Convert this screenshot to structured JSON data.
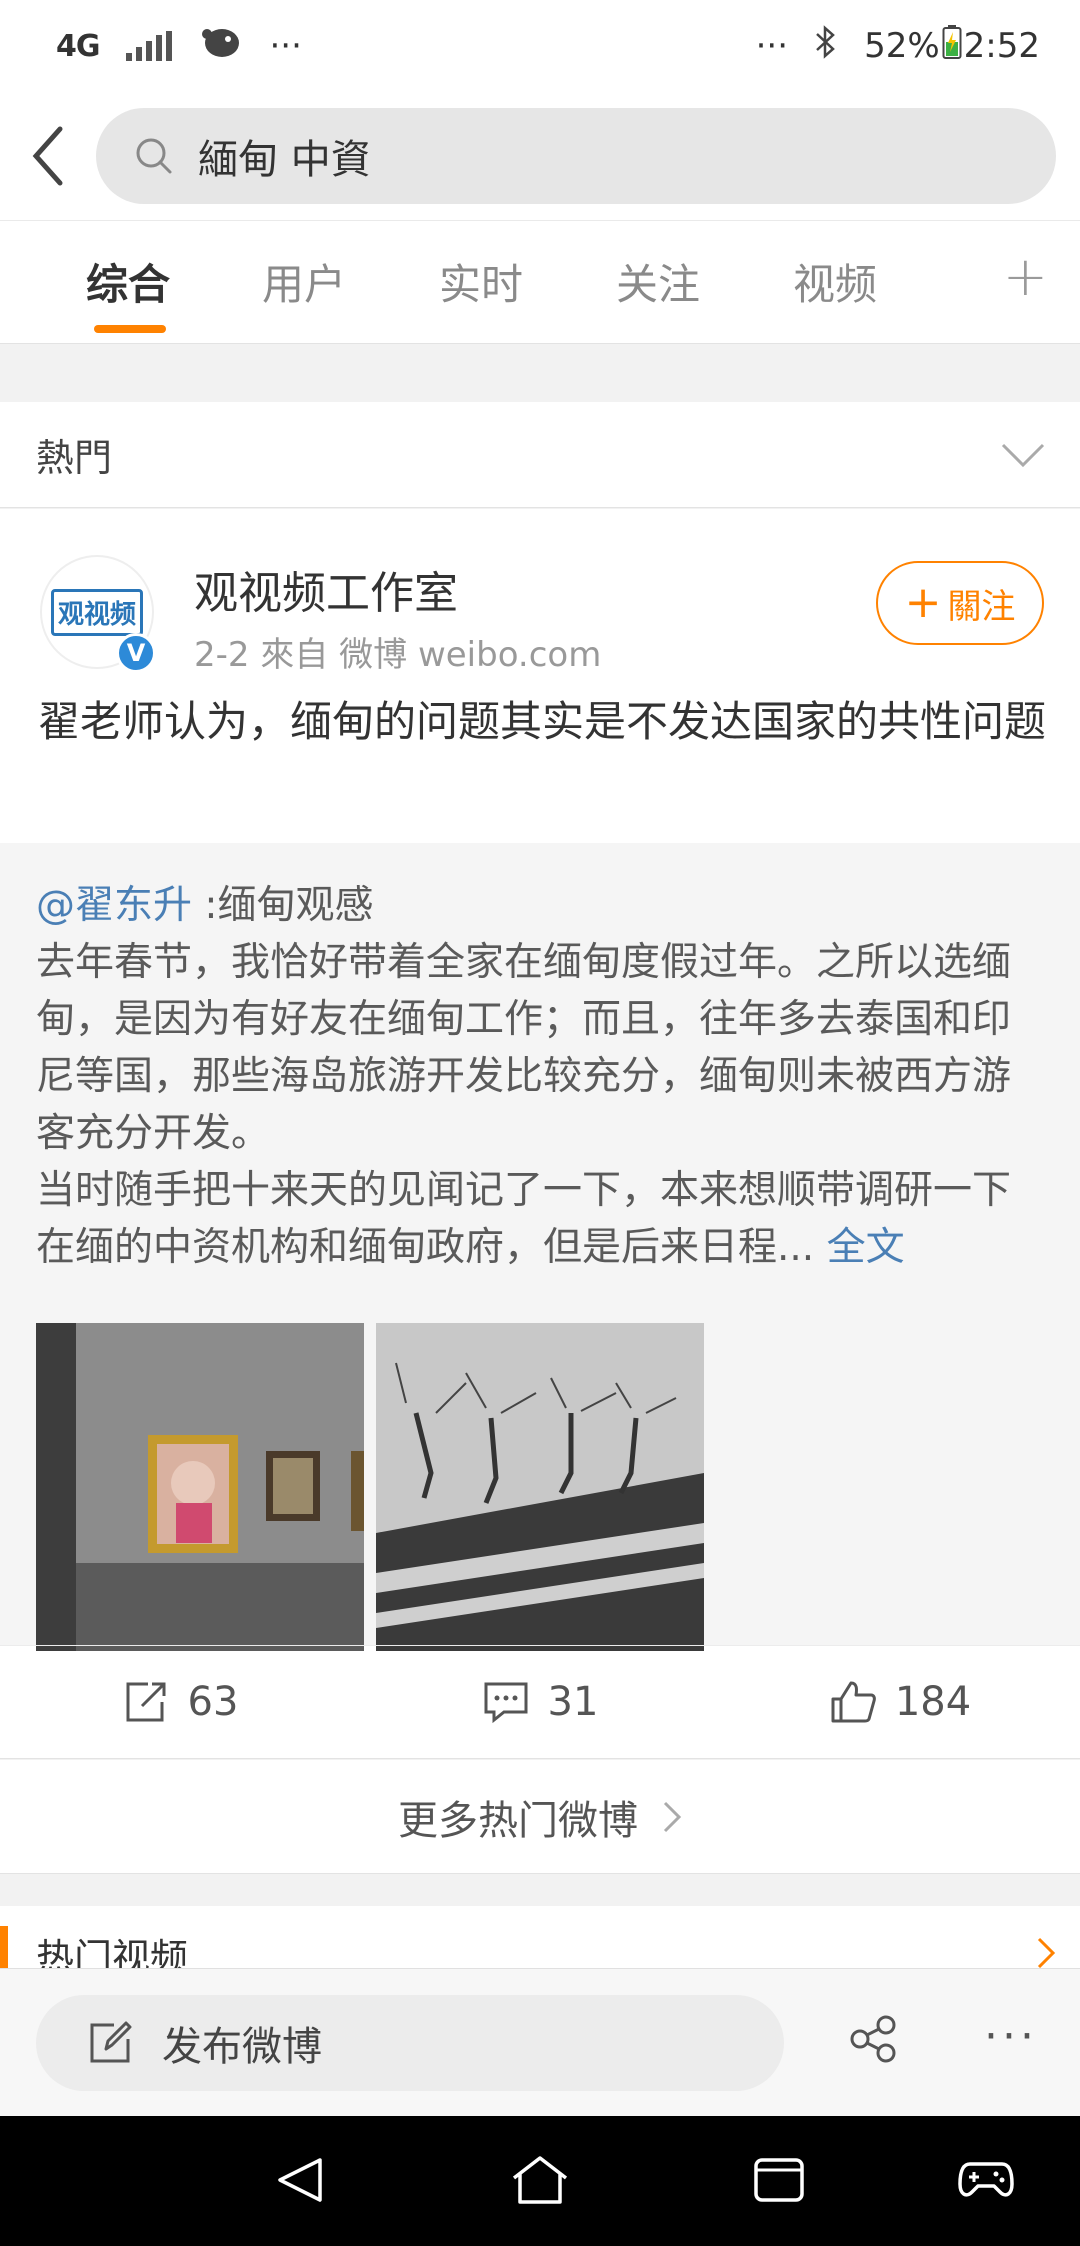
{
  "status_bar": {
    "network": "4G",
    "more_left": "···",
    "more_right": "···",
    "battery": "52%",
    "time": "2:52"
  },
  "search": {
    "query": "緬甸 中資"
  },
  "tabs": [
    {
      "label": "综合",
      "active": true
    },
    {
      "label": "用户",
      "active": false
    },
    {
      "label": "实时",
      "active": false
    },
    {
      "label": "关注",
      "active": false
    },
    {
      "label": "视频",
      "active": false
    }
  ],
  "tab_add": "+",
  "hot_section": {
    "title": "熱門"
  },
  "post": {
    "avatar_logo": "观视频",
    "verified_mark": "V",
    "user_name": "观视频工作室",
    "meta": "2-2   來自 微博 weibo.com",
    "follow_label": "關注",
    "follow_plus": "+",
    "text": "翟老师认为，缅甸的问题其实是不发达国家的共性问题",
    "repost": {
      "mention": "@翟东升",
      "title": " :缅甸观感",
      "body": "去年春节，我恰好带着全家在缅甸度假过年。之所以选缅甸，是因为有好友在缅甸工作；而且，往年多去泰国和印尼等国，那些海岛旅游开发比较充分，缅甸则未被西方游客充分开发。",
      "body2": "当时随手把十来天的见闻记了一下，本来想顺带调研一下在缅的中资机构和缅甸政府，但是后来日程...",
      "full_text": "全文"
    },
    "actions": {
      "repost_count": "63",
      "comment_count": "31",
      "like_count": "184"
    }
  },
  "more_hot": "更多热门微博",
  "hot_videos": {
    "title": "热门视频"
  },
  "compose": {
    "label": "发布微博",
    "more": "···"
  },
  "colors": {
    "accent": "#ff8200",
    "link": "#4a7fb5"
  }
}
